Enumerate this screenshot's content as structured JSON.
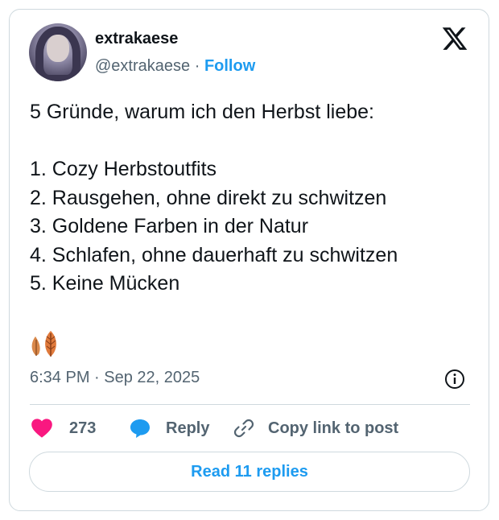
{
  "user": {
    "display_name": "extrakaese",
    "handle": "@extrakaese",
    "separator": "·",
    "follow_label": "Follow"
  },
  "tweet": {
    "lines": [
      "5 Gründe, warum ich den Herbst liebe:",
      "",
      "1. Cozy Herbstoutfits",
      "2. Rausgehen, ohne direkt zu schwitzen",
      "3. Goldene Farben in der Natur",
      "4. Schlafen, ohne dauerhaft zu schwitzen",
      "5. Keine Mücken"
    ],
    "emoji_icon": "leaves-emoji-icon",
    "timestamp": "6:34 PM · Sep 22, 2025"
  },
  "actions": {
    "like_count": "273",
    "reply_label": "Reply",
    "copy_label": "Copy link to post"
  },
  "footer": {
    "read_replies_label": "Read 11 replies"
  },
  "colors": {
    "accent": "#1d9bf0",
    "like": "#f91880",
    "text": "#0f1419",
    "muted": "#536471",
    "border": "#cfd9de"
  },
  "icons": [
    "x-logo-icon",
    "info-icon",
    "heart-icon",
    "speech-bubble-icon",
    "link-icon"
  ]
}
